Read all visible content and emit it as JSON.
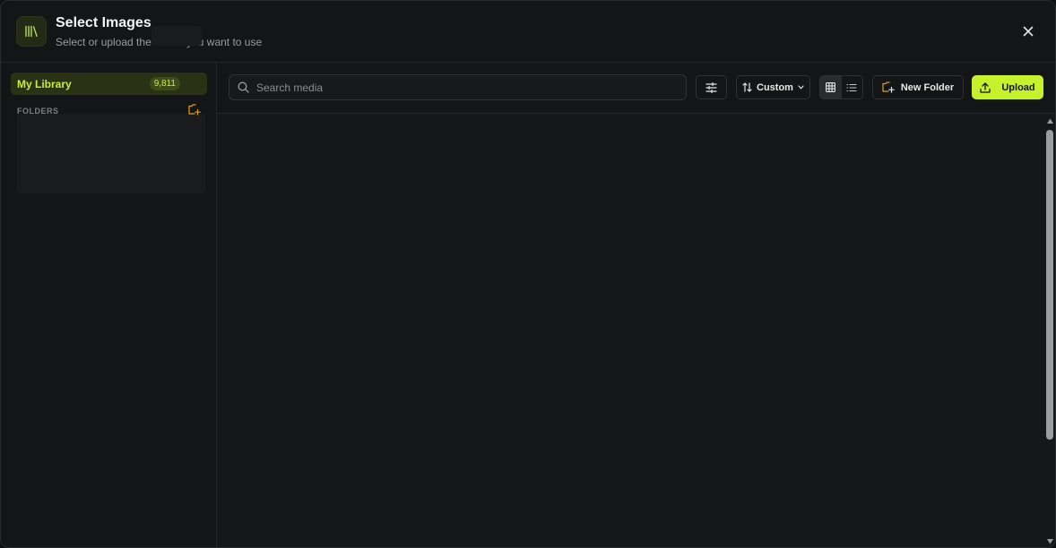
{
  "header": {
    "title": "Select Images",
    "subtitle": "Select or upload the media you want to use",
    "close_icon": "close-icon",
    "app_icon": "library-icon"
  },
  "sidebar": {
    "library_label": "My Library",
    "library_count": "9,811",
    "folders_label": "FOLDERS",
    "add_folder_icon": "folder-plus-icon"
  },
  "toolbar": {
    "search_placeholder": "Search media",
    "search_value": "",
    "sort_label": "Custom",
    "view_mode": "grid",
    "new_folder_label": "New Folder",
    "upload_label": "Upload"
  },
  "colors": {
    "accent": "#c5f12d",
    "background": "#141516",
    "border": "#26272a",
    "folder_icon": "#e0a020"
  }
}
